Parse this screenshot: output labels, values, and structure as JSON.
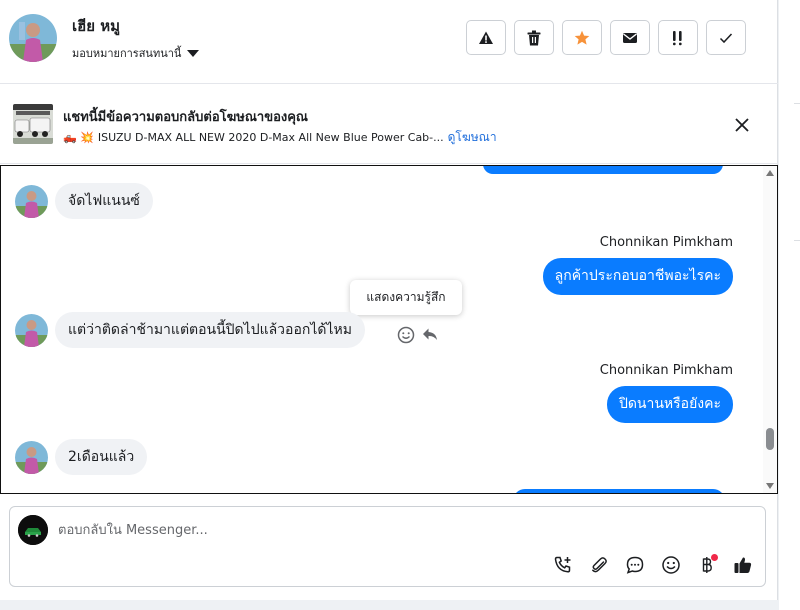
{
  "header": {
    "contact_name": "เฮีย หมู",
    "assign_label": "มอบหมายการสนทนานี้",
    "actions": [
      "spam-icon",
      "trash-icon",
      "star-icon",
      "envelope-icon",
      "follow-up-icon",
      "check-icon"
    ],
    "star_color": "#f7923a"
  },
  "ad": {
    "title": "แชทนี้มีข้อความตอบกลับต่อโฆษณาของคุณ",
    "emoji": "🛻 💥",
    "description": "ISUZU D-MAX ALL NEW 2020 D-Max All New Blue Power Cab-...",
    "link_label": "ดูโฆษณา"
  },
  "chat": {
    "messages": [
      {
        "direction": "in",
        "text": "จัดไฟแนนซ์"
      },
      {
        "direction": "out",
        "sender": "Chonnikan Pimkham",
        "text": "ลูกค้าประกอบอาชีพอะไรคะ"
      },
      {
        "direction": "in",
        "text": "แต่ว่าติดล่าช้ามาแต่ตอนนี้ปิดไปแล้วออกได้ไหม"
      },
      {
        "direction": "out",
        "sender": "Chonnikan Pimkham",
        "text": "ปิดนานหรือยังคะ"
      },
      {
        "direction": "in",
        "text": "2เดือนแล้ว"
      }
    ],
    "tooltip": "แสดงความรู้สึก"
  },
  "composer": {
    "placeholder": "ตอบกลับใน Messenger...",
    "tools": [
      "phone-add-icon",
      "attachment-icon",
      "saved-replies-icon",
      "emoji-icon",
      "payment-icon",
      "thumbs-up-icon"
    ]
  },
  "colors": {
    "brand_blue": "#0a7cff",
    "link_blue": "#216fdb",
    "incoming_bubble": "#f0f2f5"
  }
}
